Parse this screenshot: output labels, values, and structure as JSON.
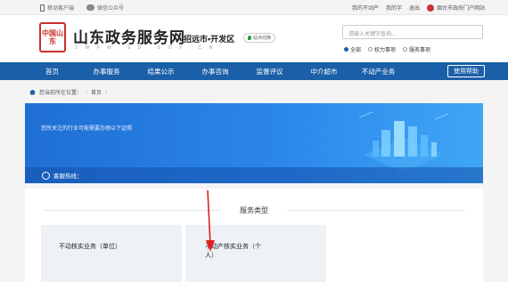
{
  "topbar": {
    "mobile_label": "移动客户端",
    "wechat_label": "微信公众号",
    "links": [
      "我的不动产",
      "我的字",
      "退出"
    ],
    "gov_portal": "烟台市政府门户网站"
  },
  "header": {
    "seal_text": "中国山东",
    "site_title": "山东政务服务网",
    "site_subtitle": "Z W F W . S D . G O V . C N",
    "region": "招远市•开发区",
    "switch_label": "站点切换",
    "search_placeholder": "请输入关键字查询...",
    "search_options": [
      "全部",
      "权力事项",
      "服务事项"
    ],
    "search_selected": "全部"
  },
  "nav": {
    "items": [
      "首页",
      "办事服务",
      "结果公示",
      "办事咨询",
      "监督评议",
      "中介超市",
      "不动产业务"
    ],
    "help_label": "使用帮助"
  },
  "breadcrumb": {
    "prefix": "您当前所在位置：",
    "current": "首页"
  },
  "banner": {
    "message": "您所关注的行业可能需要办理以下证照",
    "hotline": "客服热线："
  },
  "content": {
    "section_title": "服务类型",
    "cards": [
      {
        "label": "不动核实业务（单位）"
      },
      {
        "label": "不动产核实业务（个人）"
      }
    ]
  },
  "colors": {
    "nav_blue": "#1a5fa8",
    "banner_blue": "#2b86ea",
    "seal_red": "#c9302c",
    "annotation_arrow": "#e02020"
  }
}
